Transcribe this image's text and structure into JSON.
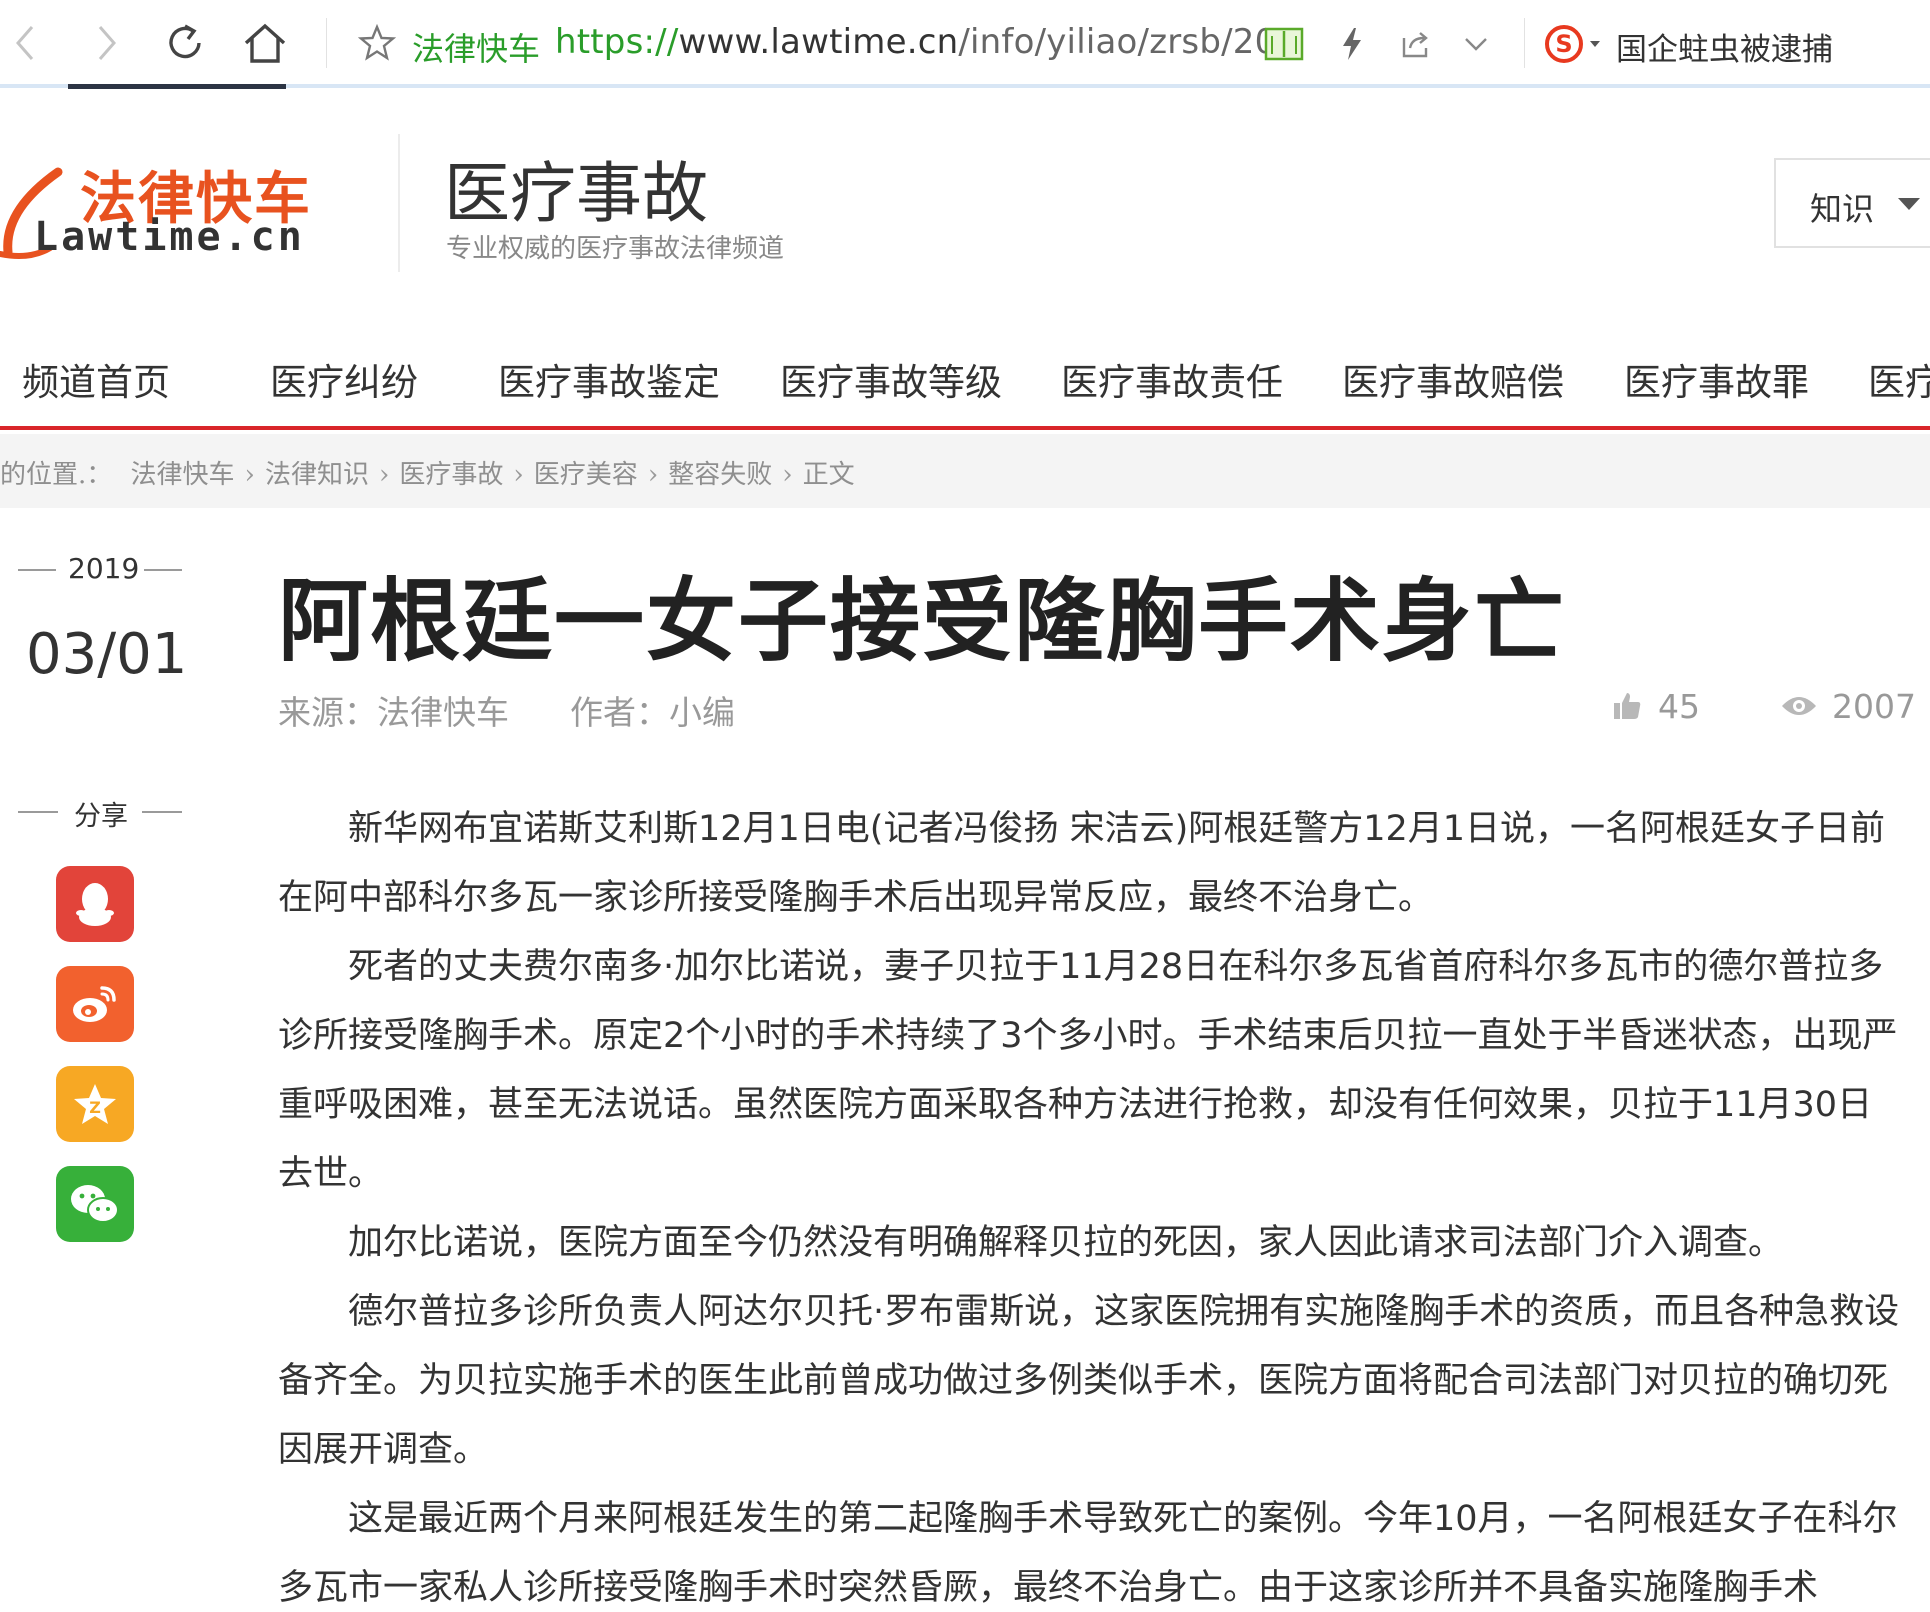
{
  "browser": {
    "back_icon": "chevron-left-icon",
    "forward_icon": "chevron-right-icon",
    "reload_icon": "reload-icon",
    "home_icon": "home-icon",
    "bookmark_icon": "star-icon",
    "site_name": "法律快车",
    "url_scheme": "https://",
    "url_host": "www.lawtime.cn",
    "url_path": "/info/yiliao/zrsb/201",
    "reader_icon": "book-icon",
    "lightning_icon": "lightning-icon",
    "share_icon": "share-icon",
    "dropdown_icon": "chevron-down-icon",
    "search_engine_icon": "sogou-icon",
    "search_hint": "国企蛀虫被逮捕"
  },
  "header": {
    "logo_cn": "法律快车",
    "logo_en": "Lawtime.cn",
    "channel_title": "医疗事故",
    "channel_subtitle": "专业权威的医疗事故法律频道",
    "search_select_label": "知识"
  },
  "nav": {
    "items": [
      "频道首页",
      "医疗纠纷",
      "医疗事故鉴定",
      "医疗事故等级",
      "医疗事故责任",
      "医疗事故赔偿",
      "医疗事故罪",
      "医疗"
    ]
  },
  "breadcrumb": {
    "prefix": "的位置.：",
    "items": [
      "法律快车",
      "法律知识",
      "医疗事故",
      "医疗美容",
      "整容失败",
      "正文"
    ],
    "separator": "›"
  },
  "date": {
    "year": "2019",
    "month_day": "03/01"
  },
  "share": {
    "label": "分享",
    "buttons": [
      {
        "name": "qq-share-button",
        "icon": "qq-icon",
        "color": "#e2443a"
      },
      {
        "name": "weibo-share-button",
        "icon": "weibo-icon",
        "color": "#f2612e"
      },
      {
        "name": "qzone-share-button",
        "icon": "qzone-star-icon",
        "color": "#f7a824"
      },
      {
        "name": "wechat-share-button",
        "icon": "wechat-icon",
        "color": "#37b03a"
      }
    ]
  },
  "article": {
    "title": "阿根廷一女子接受隆胸手术身亡",
    "source": "来源：法律快车",
    "author": "作者：小编",
    "likes": "45",
    "views": "2007",
    "paragraphs": [
      "新华网布宜诺斯艾利斯12月1日电(记者冯俊扬 宋洁云)阿根廷警方12月1日说，一名阿根廷女子日前在阿中部科尔多瓦一家诊所接受隆胸手术后出现异常反应，最终不治身亡。",
      "死者的丈夫费尔南多·加尔比诺说，妻子贝拉于11月28日在科尔多瓦省首府科尔多瓦市的德尔普拉多诊所接受隆胸手术。原定2个小时的手术持续了3个多小时。手术结束后贝拉一直处于半昏迷状态，出现严重呼吸困难，甚至无法说话。虽然医院方面采取各种方法进行抢救，却没有任何效果，贝拉于11月30日去世。",
      "加尔比诺说，医院方面至今仍然没有明确解释贝拉的死因，家人因此请求司法部门介入调查。",
      "德尔普拉多诊所负责人阿达尔贝托·罗布雷斯说，这家医院拥有实施隆胸手术的资质，而且各种急救设备齐全。为贝拉实施手术的医生此前曾成功做过多例类似手术，医院方面将配合司法部门对贝拉的确切死因展开调查。",
      "这是最近两个月来阿根廷发生的第二起隆胸手术导致死亡的案例。今年10月，一名阿根廷女子在科尔多瓦市一家私人诊所接受隆胸手术时突然昏厥，最终不治身亡。由于这家诊所并不具备实施隆胸手术"
    ]
  },
  "colors": {
    "accent_red": "#d9252a",
    "logo_orange": "#e8521f",
    "url_green": "#2a9d2a",
    "muted_text": "#999999"
  }
}
